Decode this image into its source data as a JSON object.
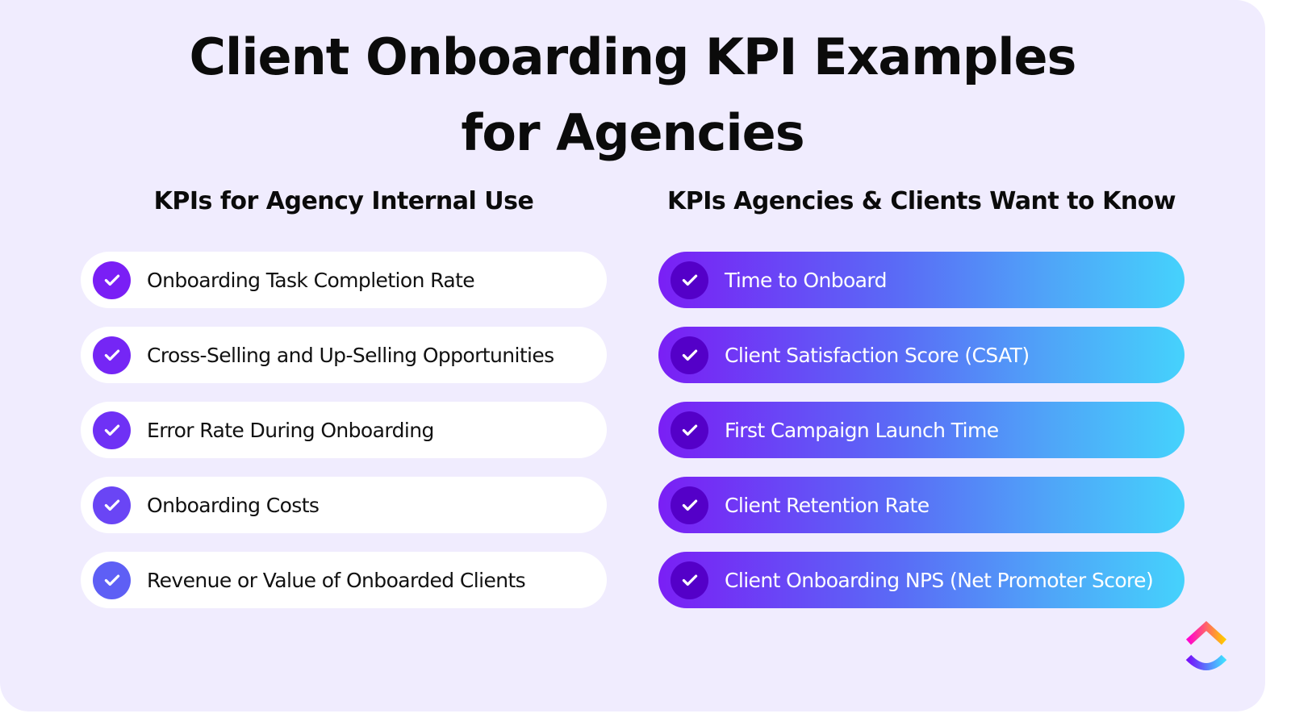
{
  "title": {
    "line1": "Client Onboarding KPI Examples",
    "line2": "for Agencies"
  },
  "columns": {
    "left": {
      "heading": "KPIs for Agency Internal Use",
      "items": [
        {
          "label": "Onboarding Task Completion Rate",
          "icon": "check-icon",
          "icon_color": "#7A1FF5"
        },
        {
          "label": "Cross-Selling and Up-Selling Opportunities",
          "icon": "check-icon",
          "icon_color": "#7526F5"
        },
        {
          "label": "Error Rate During Onboarding",
          "icon": "check-icon",
          "icon_color": "#6F31F5"
        },
        {
          "label": "Onboarding Costs",
          "icon": "check-icon",
          "icon_color": "#6A45F5"
        },
        {
          "label": "Revenue or Value of Onboarded Clients",
          "icon": "check-icon",
          "icon_color": "#5E5FF5"
        }
      ]
    },
    "right": {
      "heading": "KPIs Agencies & Clients Want to Know",
      "items": [
        {
          "label": "Time to Onboard",
          "icon": "check-icon"
        },
        {
          "label": "Client Satisfaction Score (CSAT)",
          "icon": "check-icon"
        },
        {
          "label": "First Campaign Launch Time",
          "icon": "check-icon"
        },
        {
          "label": "Client Retention Rate",
          "icon": "check-icon"
        },
        {
          "label": "Client Onboarding NPS (Net Promoter Score)",
          "icon": "check-icon"
        }
      ]
    }
  },
  "brand": {
    "logo": "clickup-logo-icon",
    "colors": {
      "background": "#F0ECFE",
      "accent_purple": "#7A1FF5",
      "accent_cyan": "#45D2FC",
      "check_dark": "#5400C8"
    }
  }
}
